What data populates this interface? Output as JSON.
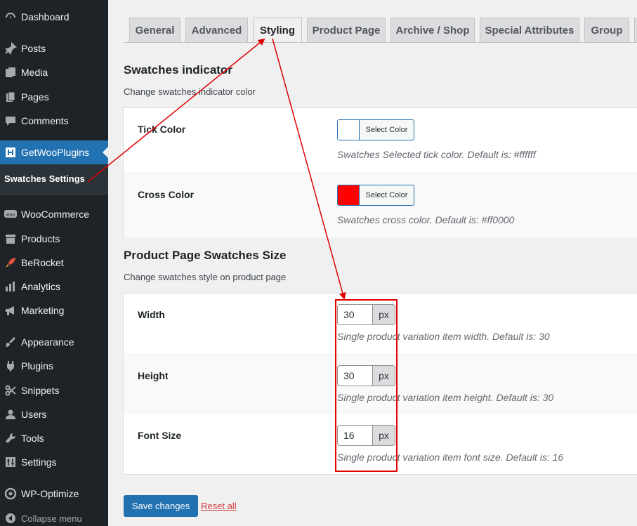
{
  "sidebar": {
    "items": [
      {
        "label": "Dashboard",
        "icon": "dashboard-icon"
      },
      {
        "label": "Posts",
        "icon": "pin-icon"
      },
      {
        "label": "Media",
        "icon": "media-icon"
      },
      {
        "label": "Pages",
        "icon": "pages-icon"
      },
      {
        "label": "Comments",
        "icon": "comments-icon"
      },
      {
        "label": "GetWooPlugins",
        "icon": "plugin-icon"
      },
      {
        "label": "WooCommerce",
        "icon": "woo-icon"
      },
      {
        "label": "Products",
        "icon": "archive-icon"
      },
      {
        "label": "BeRocket",
        "icon": "rocket-icon"
      },
      {
        "label": "Analytics",
        "icon": "bar-chart-icon"
      },
      {
        "label": "Marketing",
        "icon": "megaphone-icon"
      },
      {
        "label": "Appearance",
        "icon": "brush-icon"
      },
      {
        "label": "Plugins",
        "icon": "plugins-icon"
      },
      {
        "label": "Snippets",
        "icon": "scissors-icon"
      },
      {
        "label": "Users",
        "icon": "user-icon"
      },
      {
        "label": "Tools",
        "icon": "wrench-icon"
      },
      {
        "label": "Settings",
        "icon": "settings-icon"
      },
      {
        "label": "WP-Optimize",
        "icon": "optimize-icon"
      }
    ],
    "submenu_item": "Swatches Settings",
    "collapse": "Collapse menu"
  },
  "tabs": [
    "General",
    "Advanced",
    "Styling",
    "Product Page",
    "Archive / Shop",
    "Special Attributes",
    "Group"
  ],
  "active_tab": "Styling",
  "indicator": {
    "title": "Swatches indicator",
    "desc": "Change swatches indicator color",
    "tick": {
      "label": "Tick Color",
      "button": "Select Color",
      "color": "#ffffff",
      "help": "Swatches Selected tick color. Default is: #ffffff"
    },
    "cross": {
      "label": "Cross Color",
      "button": "Select Color",
      "color": "#ff0000",
      "help": "Swatches cross color. Default is: #ff0000"
    }
  },
  "size": {
    "title": "Product Page Swatches Size",
    "desc": "Change swatches style on product page",
    "width": {
      "label": "Width",
      "value": "30",
      "unit": "px",
      "help": "Single product variation item width. Default is: 30"
    },
    "height": {
      "label": "Height",
      "value": "30",
      "unit": "px",
      "help": "Single product variation item height. Default is: 30"
    },
    "font": {
      "label": "Font Size",
      "value": "16",
      "unit": "px",
      "help": "Single product variation item font size. Default is: 16"
    }
  },
  "actions": {
    "save": "Save changes",
    "reset": "Reset all"
  },
  "colors": {
    "sidebar_bg": "#1d2327",
    "active_menu": "#2271b1",
    "annotation": "#e00000"
  }
}
